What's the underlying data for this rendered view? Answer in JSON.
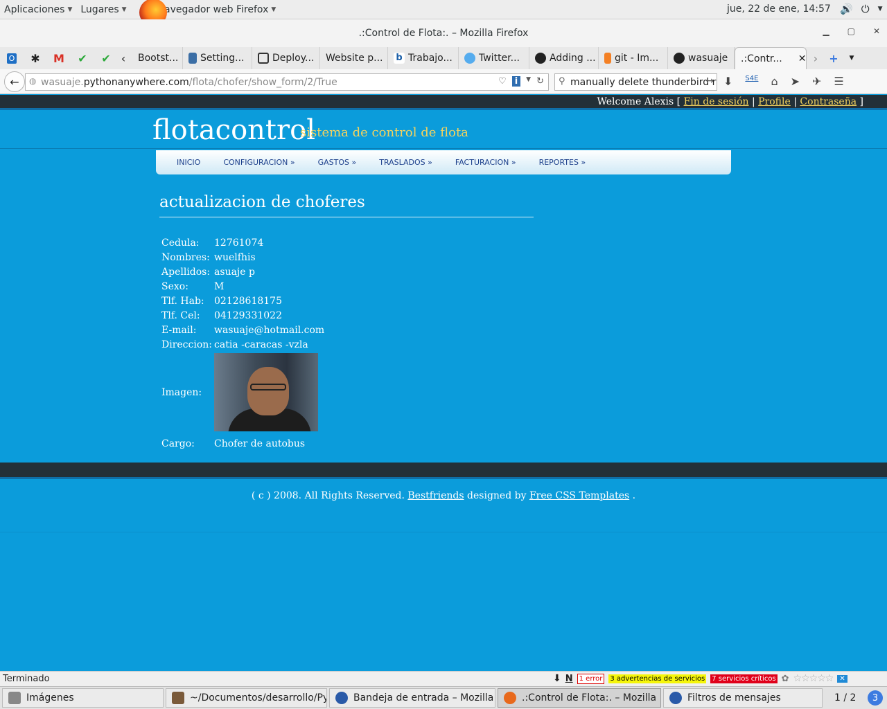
{
  "gnome": {
    "apps": "Aplicaciones",
    "places": "Lugares",
    "active_app": "Navegador web Firefox",
    "clock": "jue, 22 de ene, 14:57"
  },
  "window": {
    "title": ".:Control de Flota:. – Mozilla Firefox"
  },
  "tabs": [
    {
      "label": "Bootst...",
      "icon": "page-icon",
      "color": "#555555"
    },
    {
      "label": "Setting...",
      "icon": "python-icon",
      "color": "#3b6ea5"
    },
    {
      "label": "Deploy...",
      "icon": "book-icon",
      "color": "#333333"
    },
    {
      "label": "Website p...",
      "icon": "blank-icon",
      "color": "#e9e9e9"
    },
    {
      "label": "Trabajo...",
      "icon": "b-icon",
      "color": "#1b5fa8"
    },
    {
      "label": "Twitter...",
      "icon": "twitter-icon",
      "color": "#55acee"
    },
    {
      "label": "Adding ...",
      "icon": "github-icon",
      "color": "#222222"
    },
    {
      "label": "git - Im...",
      "icon": "stackoverflow-icon",
      "color": "#f48024"
    },
    {
      "label": "wasuaje",
      "icon": "github-icon",
      "color": "#222222"
    },
    {
      "label": ".:Contr...",
      "icon": "blank-icon",
      "color": "#f7f7f7"
    }
  ],
  "urlbar": {
    "prefix": "wasuaje.",
    "host": "pythonanywhere.com",
    "path": "/flota/chofer/show_form/2/True"
  },
  "search": {
    "value": "manually delete  thunderbird r"
  },
  "site": {
    "welcome": "Welcome Alexis [",
    "logout": "Fin de sesión",
    "profile": "Profile",
    "password": "Contraseña",
    "close_bracket": "]",
    "sep": "|",
    "logo": "flotacontrol",
    "slogan": "sistema de control de flota",
    "menu": [
      "INICIO",
      "CONFIGURACION »",
      "GASTOS »",
      "TRASLADOS »",
      "FACTURACION »",
      "REPORTES »"
    ],
    "page_title": "actualizacion de choferes",
    "fields": {
      "cedula": {
        "label": "Cedula:",
        "value": "12761074"
      },
      "nombres": {
        "label": "Nombres:",
        "value": "wuelfhis"
      },
      "apellidos": {
        "label": "Apellidos:",
        "value": "asuaje p"
      },
      "sexo": {
        "label": "Sexo:",
        "value": "M"
      },
      "tlf_hab": {
        "label": "Tlf. Hab:",
        "value": "02128618175"
      },
      "tlf_cel": {
        "label": "Tlf. Cel:",
        "value": "04129331022"
      },
      "email": {
        "label": "E-mail:",
        "value": "wasuaje@hotmail.com"
      },
      "direccion": {
        "label": "Direccion:",
        "value": "catia -caracas -vzla"
      },
      "imagen": {
        "label": "Imagen:"
      },
      "cargo": {
        "label": "Cargo:",
        "value": "Chofer de autobus"
      }
    },
    "footer": {
      "prefix": "( c ) 2008. All Rights Reserved.",
      "link1": "Bestfriends",
      "middle": "designed by",
      "link2": "Free CSS Templates",
      "suffix": "."
    }
  },
  "status": {
    "text": "Terminado",
    "errors": "1 error",
    "warnings": "3 advertencias de servicios",
    "critical": "7 servicios críticos"
  },
  "taskbar": {
    "items": [
      {
        "label": "Imágenes",
        "icon": "image-viewer-icon"
      },
      {
        "label": "~/Documentos/desarrollo/Py...",
        "icon": "editor-icon"
      },
      {
        "label": "Bandeja de entrada – Mozilla ...",
        "icon": "thunderbird-icon"
      },
      {
        "label": ".:Control de Flota:. – Mozilla ...",
        "icon": "firefox-icon"
      },
      {
        "label": "Filtros de mensajes",
        "icon": "thunderbird-icon"
      }
    ],
    "workspace": "1 / 2",
    "badge": "3"
  },
  "colors": {
    "page_bg": "#0b9cdb",
    "dark_strip": "#233038",
    "link_yellow": "#f4d35e",
    "menu_text": "#1b3f8b"
  }
}
